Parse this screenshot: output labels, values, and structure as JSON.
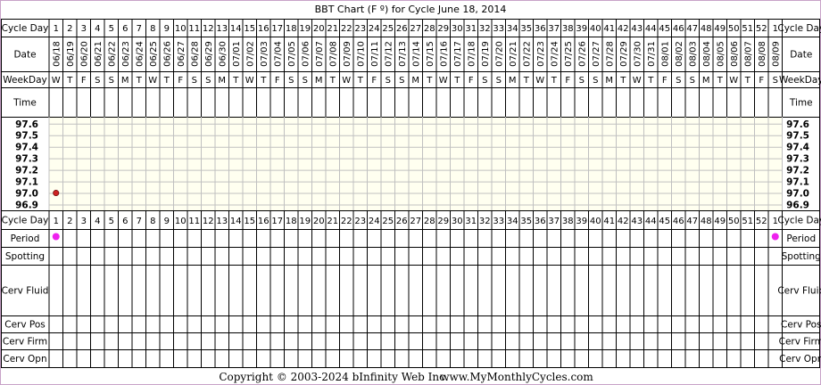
{
  "chart_data": {
    "type": "scatter",
    "title": "BBT Chart (F º) for Cycle June 18, 2014",
    "cycle_days": [
      "1",
      "2",
      "3",
      "4",
      "5",
      "6",
      "7",
      "8",
      "9",
      "10",
      "11",
      "12",
      "13",
      "14",
      "15",
      "16",
      "17",
      "18",
      "19",
      "20",
      "21",
      "22",
      "23",
      "24",
      "25",
      "26",
      "27",
      "28",
      "29",
      "30",
      "31",
      "32",
      "33",
      "34",
      "35",
      "36",
      "37",
      "38",
      "39",
      "40",
      "41",
      "42",
      "43",
      "44",
      "45",
      "46",
      "47",
      "48",
      "49",
      "50",
      "51",
      "52",
      "1"
    ],
    "dates": [
      "06/18",
      "06/19",
      "06/20",
      "06/21",
      "06/22",
      "06/23",
      "06/24",
      "06/25",
      "06/26",
      "06/27",
      "06/28",
      "06/29",
      "06/30",
      "07/01",
      "07/02",
      "07/03",
      "07/04",
      "07/05",
      "07/06",
      "07/07",
      "07/08",
      "07/09",
      "07/10",
      "07/11",
      "07/12",
      "07/13",
      "07/14",
      "07/15",
      "07/16",
      "07/17",
      "07/18",
      "07/19",
      "07/20",
      "07/21",
      "07/22",
      "07/23",
      "07/24",
      "07/25",
      "07/26",
      "07/27",
      "07/28",
      "07/29",
      "07/30",
      "07/31",
      "08/01",
      "08/02",
      "08/03",
      "08/04",
      "08/05",
      "08/06",
      "08/07",
      "08/08",
      "08/09"
    ],
    "weekdays": [
      "W",
      "T",
      "F",
      "S",
      "S",
      "M",
      "T",
      "W",
      "T",
      "F",
      "S",
      "S",
      "M",
      "T",
      "W",
      "T",
      "F",
      "S",
      "S",
      "M",
      "T",
      "W",
      "T",
      "F",
      "S",
      "S",
      "M",
      "T",
      "W",
      "T",
      "F",
      "S",
      "S",
      "M",
      "T",
      "W",
      "T",
      "F",
      "S",
      "S",
      "M",
      "T",
      "W",
      "T",
      "F",
      "S",
      "S",
      "M",
      "T",
      "W",
      "T",
      "F",
      "S"
    ],
    "temp_labels": [
      "97.6",
      "97.5",
      "97.4",
      "97.3",
      "97.2",
      "97.1",
      "97.0",
      "96.9"
    ],
    "temp_values": [
      97.6,
      97.5,
      97.4,
      97.3,
      97.2,
      97.1,
      97.0,
      96.9
    ],
    "ylim": [
      96.9,
      97.6
    ],
    "temperatures": [
      {
        "day_index": 0,
        "value": 97.0
      }
    ],
    "period_days": [
      0,
      52
    ],
    "row_labels": {
      "cycle_day": "Cycle Day",
      "date": "Date",
      "weekday": "WeekDay",
      "time": "Time",
      "period": "Period",
      "spotting": "Spotting",
      "cerv_fluid": "Cerv Fluid",
      "cerv_pos": "Cerv Pos",
      "cerv_firm": "Cerv Firm",
      "cerv_opn": "Cerv Opn"
    },
    "colors": {
      "border": "#c8a2c8",
      "grid": "#c0c0c0",
      "temp_area": "#fffff0",
      "period_dot": "#ee22ee",
      "temp_dot": "#cc2222",
      "background": "#ffffff"
    }
  },
  "footer": {
    "copyright": "Copyright © 2003-2024 bInfinity Web Inc.",
    "site": "www.MyMonthlyCycles.com"
  }
}
